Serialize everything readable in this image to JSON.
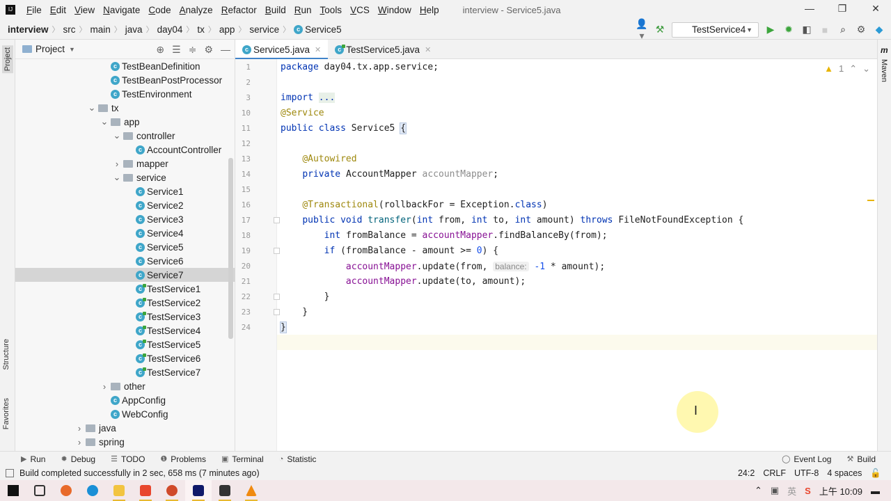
{
  "window": {
    "title": "interview - Service5.java",
    "menu": [
      "File",
      "Edit",
      "View",
      "Navigate",
      "Code",
      "Analyze",
      "Refactor",
      "Build",
      "Run",
      "Tools",
      "VCS",
      "Window",
      "Help"
    ]
  },
  "breadcrumb": [
    "interview",
    "src",
    "main",
    "java",
    "day04",
    "tx",
    "app",
    "service",
    "Service5"
  ],
  "toolbar": {
    "run_config": "TestService4"
  },
  "project": {
    "title": "Project",
    "tree": [
      {
        "label": "TestBeanDefinition",
        "depth": 2,
        "type": "class"
      },
      {
        "label": "TestBeanPostProcessor",
        "depth": 2,
        "type": "class"
      },
      {
        "label": "TestEnvironment",
        "depth": 2,
        "type": "class"
      },
      {
        "label": "tx",
        "depth": 1,
        "type": "folder",
        "expanded": true
      },
      {
        "label": "app",
        "depth": 2,
        "type": "folder",
        "expanded": true
      },
      {
        "label": "controller",
        "depth": 3,
        "type": "folder",
        "expanded": true
      },
      {
        "label": "AccountController",
        "depth": 4,
        "type": "class"
      },
      {
        "label": "mapper",
        "depth": 3,
        "type": "folder",
        "expanded": false
      },
      {
        "label": "service",
        "depth": 3,
        "type": "folder",
        "expanded": true
      },
      {
        "label": "Service1",
        "depth": 4,
        "type": "class"
      },
      {
        "label": "Service2",
        "depth": 4,
        "type": "class"
      },
      {
        "label": "Service3",
        "depth": 4,
        "type": "class"
      },
      {
        "label": "Service4",
        "depth": 4,
        "type": "class"
      },
      {
        "label": "Service5",
        "depth": 4,
        "type": "class"
      },
      {
        "label": "Service6",
        "depth": 4,
        "type": "class"
      },
      {
        "label": "Service7",
        "depth": 4,
        "type": "class",
        "selected": true
      },
      {
        "label": "TestService1",
        "depth": 4,
        "type": "test"
      },
      {
        "label": "TestService2",
        "depth": 4,
        "type": "test"
      },
      {
        "label": "TestService3",
        "depth": 4,
        "type": "test"
      },
      {
        "label": "TestService4",
        "depth": 4,
        "type": "test"
      },
      {
        "label": "TestService5",
        "depth": 4,
        "type": "test"
      },
      {
        "label": "TestService6",
        "depth": 4,
        "type": "test"
      },
      {
        "label": "TestService7",
        "depth": 4,
        "type": "test"
      },
      {
        "label": "other",
        "depth": 2,
        "type": "folder",
        "expanded": false
      },
      {
        "label": "AppConfig",
        "depth": 2,
        "type": "class"
      },
      {
        "label": "WebConfig",
        "depth": 2,
        "type": "class"
      },
      {
        "label": "java",
        "depth": 0,
        "type": "folder",
        "expanded": false
      },
      {
        "label": "spring",
        "depth": 0,
        "type": "folder",
        "expanded": false
      }
    ]
  },
  "tabs": [
    {
      "label": "Service5.java",
      "active": true,
      "type": "class"
    },
    {
      "label": "TestService5.java",
      "active": false,
      "type": "test"
    }
  ],
  "editor": {
    "warnings": "1",
    "lines": [
      {
        "n": "1",
        "t": [
          [
            "kw",
            "package "
          ],
          [
            "",
            "day04.tx.app.service;"
          ]
        ]
      },
      {
        "n": "2",
        "t": []
      },
      {
        "n": "3",
        "t": [
          [
            "kw",
            "import "
          ],
          [
            "fold",
            "..."
          ]
        ]
      },
      {
        "n": "10",
        "t": [
          [
            "ann",
            "@Service"
          ]
        ]
      },
      {
        "n": "11",
        "t": [
          [
            "kw",
            "public class "
          ],
          [
            "",
            "Service5 "
          ],
          [
            "brace",
            "{"
          ]
        ]
      },
      {
        "n": "12",
        "t": []
      },
      {
        "n": "13",
        "t": [
          [
            "",
            "    "
          ],
          [
            "ann",
            "@Autowired"
          ]
        ]
      },
      {
        "n": "14",
        "t": [
          [
            "",
            "    "
          ],
          [
            "kw",
            "private "
          ],
          [
            "",
            "AccountMapper "
          ],
          [
            "gray",
            "accountMapper"
          ],
          [
            "",
            ";"
          ]
        ]
      },
      {
        "n": "15",
        "t": []
      },
      {
        "n": "16",
        "t": [
          [
            "",
            "    "
          ],
          [
            "ann",
            "@Transactional"
          ],
          [
            "",
            "(rollbackFor = Exception."
          ],
          [
            "kw",
            "class"
          ],
          [
            "",
            ")"
          ]
        ]
      },
      {
        "n": "17",
        "t": [
          [
            "",
            "    "
          ],
          [
            "kw",
            "public void "
          ],
          [
            "fn",
            "transfer"
          ],
          [
            "",
            "("
          ],
          [
            "kw",
            "int "
          ],
          [
            "",
            "from, "
          ],
          [
            "kw",
            "int "
          ],
          [
            "",
            "to, "
          ],
          [
            "kw",
            "int "
          ],
          [
            "",
            "amount) "
          ],
          [
            "kw",
            "throws "
          ],
          [
            "",
            "FileNotFoundException {"
          ]
        ]
      },
      {
        "n": "18",
        "t": [
          [
            "",
            "        "
          ],
          [
            "kw",
            "int "
          ],
          [
            "",
            "fromBalance = "
          ],
          [
            "fld",
            "accountMapper"
          ],
          [
            "",
            ".findBalanceBy(from);"
          ]
        ]
      },
      {
        "n": "19",
        "t": [
          [
            "",
            "        "
          ],
          [
            "kw",
            "if "
          ],
          [
            "",
            "(fromBalance - amount >= "
          ],
          [
            "num",
            "0"
          ],
          [
            "",
            ") {"
          ]
        ]
      },
      {
        "n": "20",
        "t": [
          [
            "",
            "            "
          ],
          [
            "fld",
            "accountMapper"
          ],
          [
            "",
            ".update(from, "
          ],
          [
            "hint",
            "balance:"
          ],
          [
            "num",
            " -1"
          ],
          [
            "",
            " * amount);"
          ]
        ]
      },
      {
        "n": "21",
        "t": [
          [
            "",
            "            "
          ],
          [
            "fld",
            "accountMapper"
          ],
          [
            "",
            ".update(to, amount);"
          ]
        ]
      },
      {
        "n": "22",
        "t": [
          [
            "",
            "        }"
          ]
        ]
      },
      {
        "n": "23",
        "t": [
          [
            "",
            "    }"
          ]
        ]
      },
      {
        "n": "24",
        "t": [
          [
            "brace",
            "}"
          ]
        ]
      }
    ]
  },
  "side_tabs": {
    "left_top": "Project",
    "left_structure": "Structure",
    "left_favorites": "Favorites",
    "right": "Maven"
  },
  "tool_windows": [
    "Run",
    "Debug",
    "TODO",
    "Problems",
    "Terminal",
    "Statistic"
  ],
  "tool_windows_right": [
    "Event Log",
    "Build"
  ],
  "status": {
    "message": "Build completed successfully in 2 sec, 658 ms (7 minutes ago)",
    "position": "24:2",
    "line_sep": "CRLF",
    "encoding": "UTF-8",
    "indent": "4 spaces"
  },
  "taskbar": {
    "ime": "英",
    "time": "上午 10:09"
  }
}
